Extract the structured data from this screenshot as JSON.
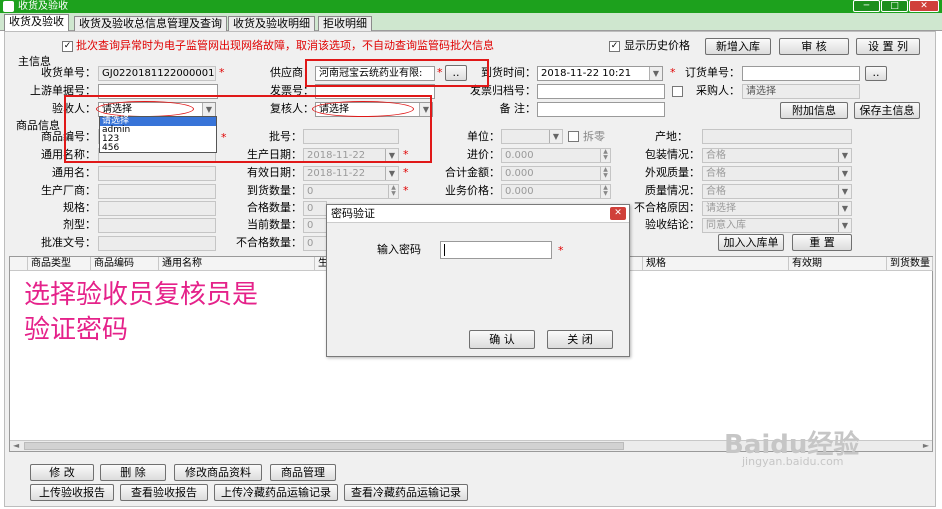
{
  "window": {
    "title": "收货及验收",
    "min": "─",
    "max": "□",
    "close": "✕"
  },
  "tabs": [
    "收货及验收",
    "收货及验收总信息管理及查询",
    "收货及验收明细",
    "拒收明细"
  ],
  "top_bar": {
    "batch_checkbox": "✓",
    "batch_note": "批次查询异常时为电子监管网出现网络故障，取消该选项，不自动查询监管码批次信息",
    "show_history_checkbox": "✓",
    "show_history_label": "显示历史价格",
    "new_button": "新增入库",
    "review_button": "审 核",
    "set_columns_button": "设 置 列"
  },
  "main_info": {
    "section": "主信息",
    "receipt_no_label": "收货单号：",
    "receipt_no": "GJ0220181122000001",
    "supplier_label": "供应商：",
    "supplier": "河南冠宝云统药业有限:",
    "supplier_btn": "..",
    "arrival_time_label": "到货时间：",
    "arrival_time": "2018-11-22 10:21",
    "order_no_label": "订货单号：",
    "order_btn": "..",
    "upstream_label": "上游单据号：",
    "invoice_no_label": "发票号：",
    "invoice_archive_label": "发票归档号：",
    "buyer_label": "采购人：",
    "buyer_value": "请选择",
    "acceptor_label": "验收人：",
    "acceptor_value": "请选择",
    "reviewer_label": "复核人：",
    "reviewer_value": "请选择",
    "remark_label": "备 注：",
    "attach_button": "附加信息",
    "save_button": "保存主信息"
  },
  "acceptor_options": [
    "请选择",
    "admin",
    "123",
    "456"
  ],
  "product_info": {
    "section": "商品信息",
    "left_labels": [
      "商品编号：",
      "通用名称：",
      "通用名：",
      "生产厂商：",
      "规格：",
      "剂型：",
      "批准文号："
    ],
    "batch_label": "批号：",
    "prod_date_label": "生产日期：",
    "prod_date": "2018-11-22",
    "exp_date_label": "有效日期：",
    "exp_date": "2018-11-22",
    "arrival_qty_label": "到货数量：",
    "arrival_qty": "0",
    "qualified_qty_label": "合格数量：",
    "qualified_qty": "0",
    "current_qty_label": "当前数量：",
    "current_qty": "0",
    "unqualified_qty_label": "不合格数量：",
    "unqualified_qty": "0",
    "unit_label": "单位：",
    "split_label": "拆零",
    "price_label": "进价：",
    "price": "0.000",
    "total_label": "合计金额：",
    "total": "0.000",
    "biz_price_label": "业务价格：",
    "biz_price": "0.000",
    "origin_label": "产地：",
    "pack_label": "包装情况：",
    "pack": "合格",
    "appearance_label": "外观质量：",
    "appearance": "合格",
    "quality_label": "质量情况：",
    "quality": "合格",
    "unq_reason_label": "不合格原因：",
    "unq_reason": "请选择",
    "conclusion_label": "验收结论：",
    "conclusion": "同意入库",
    "add_button": "加入入库单",
    "reset_button": "重 置"
  },
  "grid_columns": [
    "商品类型",
    "商品编码",
    "通用名称",
    "生",
    "规格",
    "有效期",
    "到货数量"
  ],
  "dialog": {
    "title": "密码验证",
    "password_label": "输入密码",
    "ok": "确 认",
    "close": "关 闭"
  },
  "bottom_buttons": {
    "modify": "修 改",
    "delete": "删 除",
    "modify_product": "修改商品资料",
    "product_mgmt": "商品管理",
    "upload_report": "上传验收报告",
    "view_report": "查看验收报告",
    "upload_cold": "上传冷藏药品运输记录",
    "view_cold": "查看冷藏药品运输记录"
  },
  "annotation": [
    "选择验收员复核员是",
    "验证密码"
  ],
  "watermark": {
    "brand": "Baidu经验",
    "url": "jingyan.baidu.com"
  },
  "colors": {
    "titlebar": "#1da11d",
    "required": "#e00000",
    "highlight": "#e01818",
    "annotation": "#e5228a"
  }
}
